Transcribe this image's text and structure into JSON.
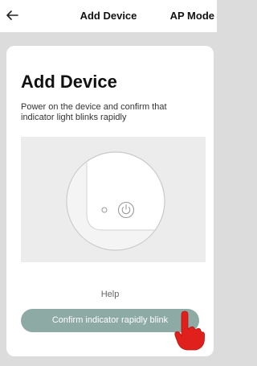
{
  "header": {
    "back_icon": "back-arrow-icon",
    "title": "Add Device",
    "action_label": "AP Mode"
  },
  "main": {
    "heading": "Add Device",
    "instruction": "Power on the device and confirm that indicator light blinks rapidly",
    "illustration_icons": [
      "indicator-light-icon",
      "power-button-icon"
    ],
    "help_label": "Help",
    "confirm_label": "Confirm indicator rapidly blink",
    "pointer_icon": "tap-hand-icon"
  },
  "colors": {
    "background": "#dcdcdc",
    "card": "#ffffff",
    "illustration_bg": "#ececec",
    "confirm_button": "#8eaaa4",
    "pointer_hand": "#e0201c"
  }
}
